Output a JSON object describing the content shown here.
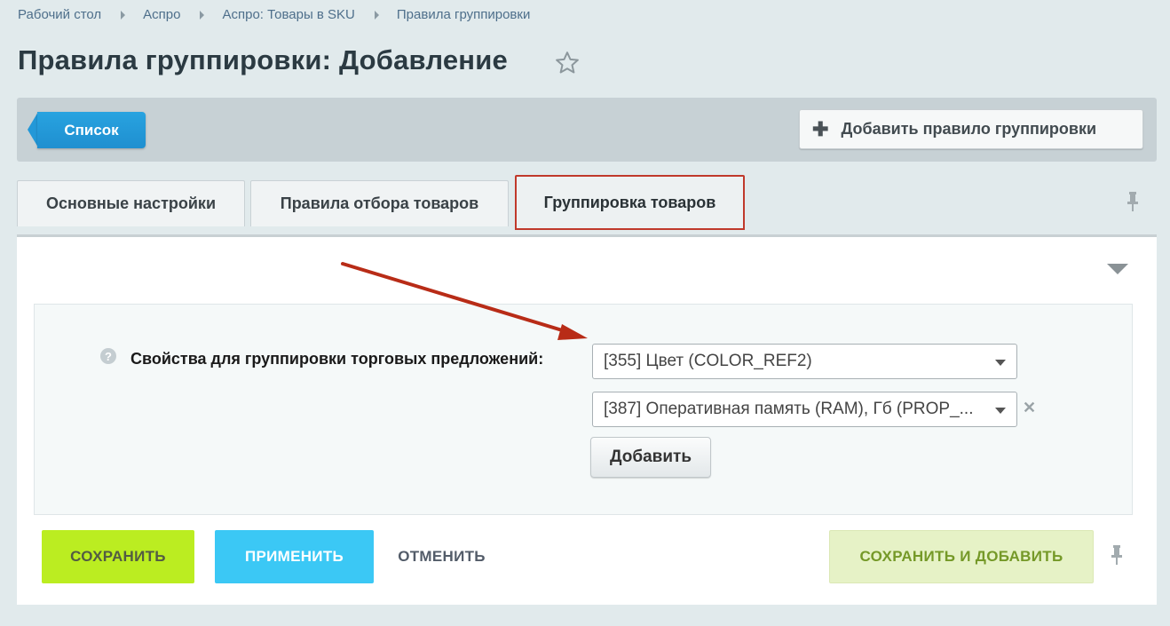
{
  "breadcrumb": [
    "Рабочий стол",
    "Аспро",
    "Аспро: Товары в SKU",
    "Правила группировки"
  ],
  "page_title": "Правила группировки: Добавление",
  "toolbar": {
    "list_button": "Список",
    "add_rule_button": "Добавить правило группировки"
  },
  "tabs": [
    {
      "label": "Основные настройки"
    },
    {
      "label": "Правила отбора товаров"
    },
    {
      "label": "Группировка товаров",
      "active": true
    }
  ],
  "form": {
    "field_label": "Свойства для группировки торговых предложений:",
    "help_glyph": "?",
    "select_values": [
      "[355] Цвет (COLOR_REF2)",
      "[387] Оперативная память (RAM), Гб (PROP_..."
    ],
    "add_button": "Добавить",
    "remove_glyph": "✕"
  },
  "footer": {
    "save": "СОХРАНИТЬ",
    "apply": "ПРИМЕНИТЬ",
    "cancel": "ОТМЕНИТЬ",
    "save_and_add": "СОХРАНИТЬ И ДОБАВИТЬ"
  },
  "colors": {
    "accent_blue": "#2398d8",
    "save_green": "#bbed21",
    "apply_blue": "#3bc8f5",
    "active_tab_border": "#c0392b",
    "annotation_arrow": "#b82c17"
  },
  "icons": [
    "star-icon",
    "plus-icon",
    "pin-icon",
    "collapse-icon",
    "help-icon",
    "remove-icon",
    "chevron-down-icon",
    "annotation-arrow"
  ]
}
